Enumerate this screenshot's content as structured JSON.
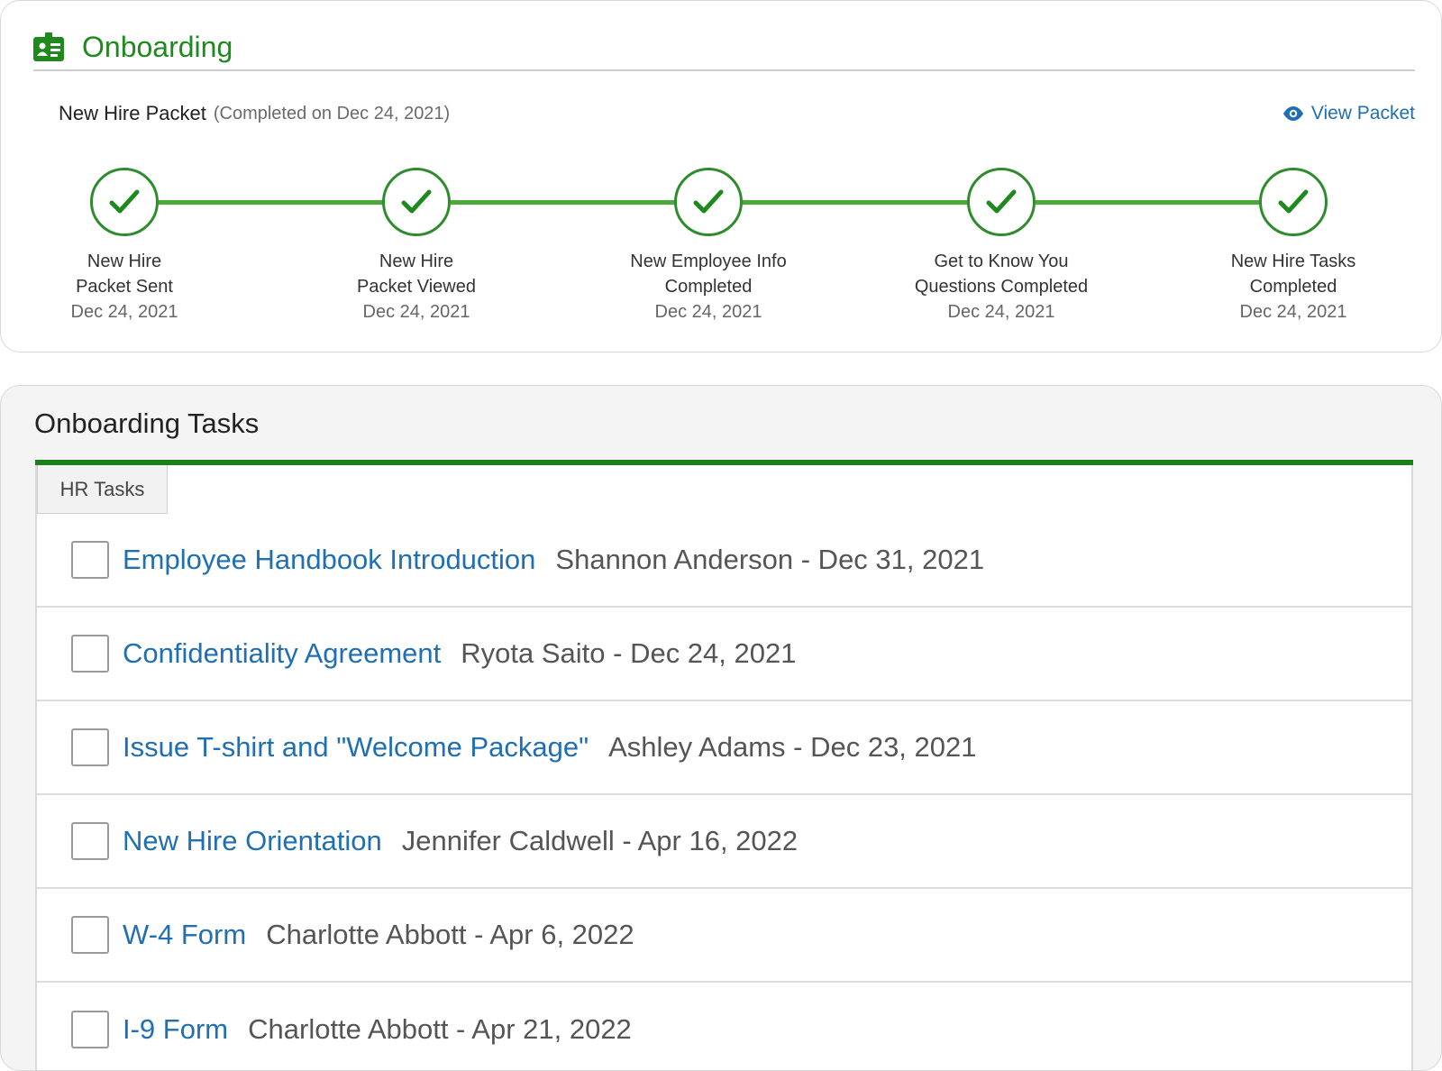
{
  "onboarding": {
    "title": "Onboarding",
    "icon": "id-card-icon",
    "accent_color": "#1e8a1e"
  },
  "packet": {
    "label": "New Hire Packet",
    "status": "(Completed on Dec 24, 2021)",
    "view_link": "View Packet",
    "view_icon": "eye-icon"
  },
  "steps": [
    {
      "line1": "New Hire",
      "line2": "Packet Sent",
      "date": "Dec 24, 2021",
      "completed": true
    },
    {
      "line1": "New Hire",
      "line2": "Packet Viewed",
      "date": "Dec 24, 2021",
      "completed": true
    },
    {
      "line1": "New Employee Info",
      "line2": "Completed",
      "date": "Dec 24, 2021",
      "completed": true
    },
    {
      "line1": "Get to Know You",
      "line2": "Questions Completed",
      "date": "Dec 24, 2021",
      "completed": true
    },
    {
      "line1": "New Hire Tasks",
      "line2": "Completed",
      "date": "Dec 24, 2021",
      "completed": true
    }
  ],
  "tasks_section": {
    "title": "Onboarding Tasks",
    "tab": "HR Tasks",
    "items": [
      {
        "name": "Employee Handbook Introduction",
        "meta": "Shannon Anderson - Dec 31, 2021",
        "checked": false
      },
      {
        "name": "Confidentiality Agreement",
        "meta": "Ryota Saito - Dec 24, 2021",
        "checked": false
      },
      {
        "name": "Issue T-shirt and \"Welcome Package\"",
        "meta": "Ashley Adams - Dec 23, 2021",
        "checked": false
      },
      {
        "name": "New Hire Orientation",
        "meta": "Jennifer Caldwell - Apr 16, 2022",
        "checked": false
      },
      {
        "name": "W-4 Form",
        "meta": "Charlotte Abbott - Apr 6, 2022",
        "checked": false
      },
      {
        "name": "I-9 Form",
        "meta": "Charlotte Abbott - Apr 21, 2022",
        "checked": false
      }
    ]
  },
  "colors": {
    "link": "#1f6fb2",
    "progress_line": "#4caa3a",
    "tab_bar": "#1b7f1b"
  }
}
